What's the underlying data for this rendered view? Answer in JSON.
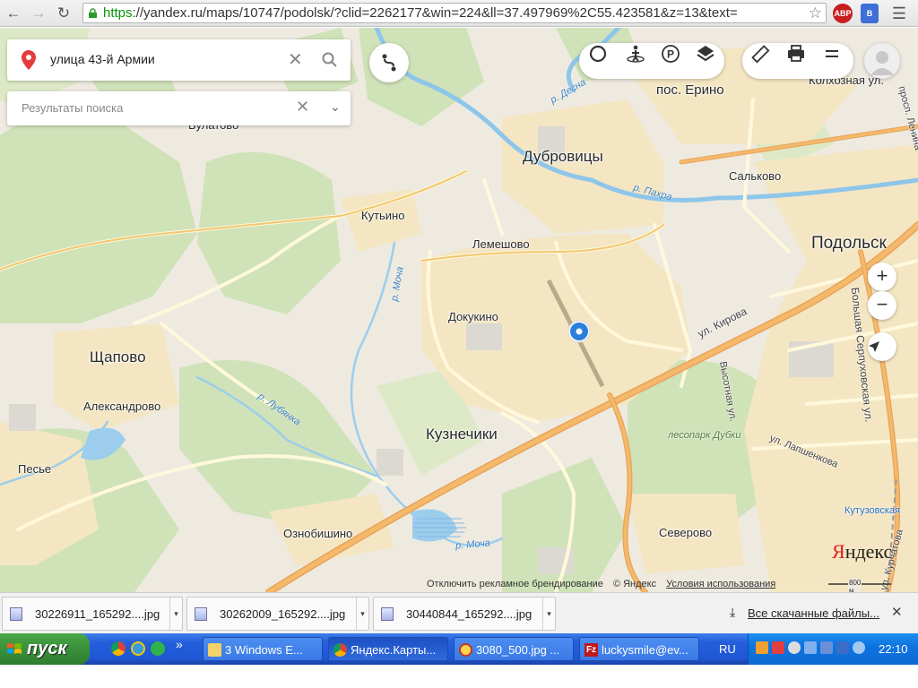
{
  "browser": {
    "url_scheme": "https",
    "url_rest": "://yandex.ru/maps/10747/podolsk/?clid=2262177&win=224&ll=37.497969%2C55.423581&z=13&text=",
    "back_icon": "arrow-left",
    "forward_icon": "arrow-right",
    "reload_icon": "reload",
    "star_icon": "star",
    "ext_abp": "ABP",
    "ext_b": "B",
    "menu_icon": "hamburger"
  },
  "search": {
    "query": "улица 43-й Армии",
    "results_placeholder": "Результаты поиска"
  },
  "map": {
    "places": [
      {
        "id": "vulatovo",
        "label": "Вулатово"
      },
      {
        "id": "erino",
        "label": "пос. Ерино"
      },
      {
        "id": "kolkhoznaya",
        "label": "Колхозная ул."
      },
      {
        "id": "dubrovitsy",
        "label": "Дубровицы"
      },
      {
        "id": "salkovo",
        "label": "Сальково"
      },
      {
        "id": "kutino",
        "label": "Кутьино"
      },
      {
        "id": "lemeshovo",
        "label": "Лемешово"
      },
      {
        "id": "podolsk",
        "label": "Подольск"
      },
      {
        "id": "dokukino",
        "label": "Докукино"
      },
      {
        "id": "schapovo",
        "label": "Щапово"
      },
      {
        "id": "aleksandrovo",
        "label": "Александрово"
      },
      {
        "id": "kuznechiki",
        "label": "Кузнечики"
      },
      {
        "id": "pesye",
        "label": "Песье"
      },
      {
        "id": "oznobishino",
        "label": "Ознобишино"
      },
      {
        "id": "severovo",
        "label": "Северово"
      }
    ],
    "rivers": [
      {
        "id": "desna",
        "label": "р. Десна"
      },
      {
        "id": "pakhra",
        "label": "р. Пахра"
      },
      {
        "id": "mocha1",
        "label": "р. Моча"
      },
      {
        "id": "lubyanka",
        "label": "р. Лубянка"
      },
      {
        "id": "mocha2",
        "label": "р. Моча"
      }
    ],
    "streets": [
      {
        "id": "kirova",
        "label": "ул. Кирова"
      },
      {
        "id": "vysotnaya",
        "label": "Высотная ул."
      },
      {
        "id": "bserp",
        "label": "Большая Серпуховская ул."
      },
      {
        "id": "lapshenkova",
        "label": "ул. Лапшенкова"
      },
      {
        "id": "lenina",
        "label": "просп. Ленина"
      },
      {
        "id": "dubki",
        "label": "лесопарк Дубки"
      },
      {
        "id": "kutuz",
        "label": "Кутузовская"
      },
      {
        "id": "kurch",
        "label": "ул. Курчатова"
      }
    ],
    "copyright": {
      "branding_off": "Отключить рекламное брендирование",
      "yandex": "© Яндекс",
      "terms": "Условия использования"
    },
    "logo_first": "Я",
    "logo_rest": "ндекс",
    "scale": "800 м",
    "zoom_in": "+",
    "zoom_out": "−"
  },
  "downloads": {
    "items": [
      {
        "name": "30226911_165292....jpg"
      },
      {
        "name": "30262009_165292....jpg"
      },
      {
        "name": "30440844_165292....jpg"
      }
    ],
    "show_all": "Все скачанные файлы...",
    "close": "✕"
  },
  "taskbar": {
    "start": "пуск",
    "more": "»",
    "tasks": [
      {
        "label": "3 Windows E..."
      },
      {
        "label": "Яндекс.Карты..."
      },
      {
        "label": "3080_500.jpg ..."
      },
      {
        "label": "luckysmile@ev..."
      }
    ],
    "lang": "RU",
    "clock": "22:10"
  }
}
